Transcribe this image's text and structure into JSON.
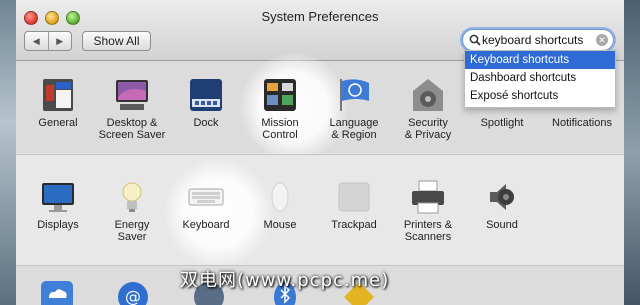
{
  "window": {
    "title": "System Preferences",
    "show_all_label": "Show All",
    "back_glyph": "◀",
    "forward_glyph": "▶"
  },
  "search": {
    "value": "keyboard shortcuts",
    "suggestions": [
      "Keyboard shortcuts",
      "Dashboard shortcuts",
      "Exposé shortcuts"
    ],
    "selected_index": 0
  },
  "rows": {
    "personal": [
      {
        "label": "General",
        "icon": "general-icon"
      },
      {
        "label": "Desktop &\nScreen Saver",
        "icon": "desktop-icon"
      },
      {
        "label": "Dock",
        "icon": "dock-icon"
      },
      {
        "label": "Mission\nControl",
        "icon": "mission-control-icon",
        "highlighted": true
      },
      {
        "label": "Language\n& Region",
        "icon": "language-icon"
      },
      {
        "label": "Security\n& Privacy",
        "icon": "security-icon"
      },
      {
        "label": "Spotlight",
        "icon": "spotlight-icon"
      },
      {
        "label": "Notifications",
        "icon": "notifications-icon"
      }
    ],
    "hardware": [
      {
        "label": "Displays",
        "icon": "displays-icon"
      },
      {
        "label": "Energy\nSaver",
        "icon": "energy-saver-icon"
      },
      {
        "label": "Keyboard",
        "icon": "keyboard-icon",
        "highlighted": true
      },
      {
        "label": "Mouse",
        "icon": "mouse-icon"
      },
      {
        "label": "Trackpad",
        "icon": "trackpad-icon"
      },
      {
        "label": "Printers &\nScanners",
        "icon": "printer-icon"
      },
      {
        "label": "Sound",
        "icon": "sound-icon"
      }
    ]
  },
  "watermark": "双电网(www.pcpc.me)",
  "colors": {
    "selection": "#2f6bd6",
    "focus_ring": "#8fb3e8"
  }
}
